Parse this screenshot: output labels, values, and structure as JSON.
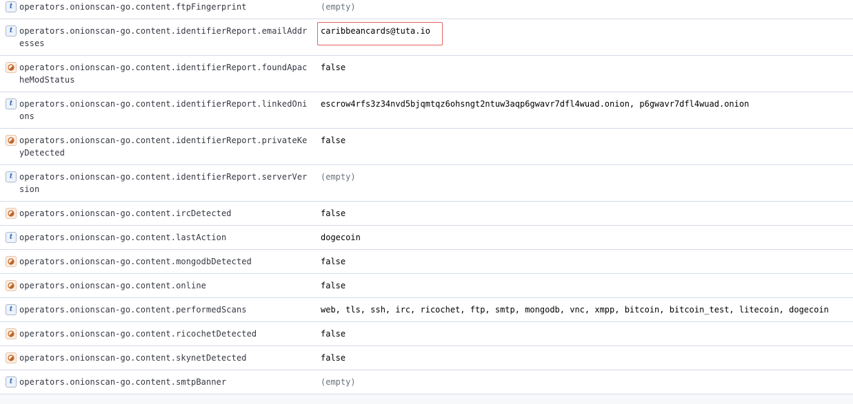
{
  "rows": [
    {
      "field": "operators.onionscan-go.content.ftpFingerprint",
      "type": "string",
      "type_glyph": "t",
      "value": "(empty)",
      "empty": true
    },
    {
      "field": "operators.onionscan-go.content.identifierReport.emailAddresses",
      "type": "string",
      "type_glyph": "t",
      "value": "caribbeancards@tuta.io",
      "empty": false,
      "highlighted": true
    },
    {
      "field": "operators.onionscan-go.content.identifierReport.foundApacheModStatus",
      "type": "boolean",
      "value": "false",
      "empty": false
    },
    {
      "field": "operators.onionscan-go.content.identifierReport.linkedOnions",
      "type": "string",
      "type_glyph": "t",
      "value": "escrow4rfs3z34nvd5bjqmtqz6ohsngt2ntuw3aqp6gwavr7dfl4wuad.onion, p6gwavr7dfl4wuad.onion",
      "empty": false
    },
    {
      "field": "operators.onionscan-go.content.identifierReport.privateKeyDetected",
      "type": "boolean",
      "value": "false",
      "empty": false
    },
    {
      "field": "operators.onionscan-go.content.identifierReport.serverVersion",
      "type": "string",
      "type_glyph": "t",
      "value": "(empty)",
      "empty": true
    },
    {
      "field": "operators.onionscan-go.content.ircDetected",
      "type": "boolean",
      "value": "false",
      "empty": false
    },
    {
      "field": "operators.onionscan-go.content.lastAction",
      "type": "string",
      "type_glyph": "t",
      "value": "dogecoin",
      "empty": false
    },
    {
      "field": "operators.onionscan-go.content.mongodbDetected",
      "type": "boolean",
      "value": "false",
      "empty": false
    },
    {
      "field": "operators.onionscan-go.content.online",
      "type": "boolean",
      "value": "false",
      "empty": false
    },
    {
      "field": "operators.onionscan-go.content.performedScans",
      "type": "string",
      "type_glyph": "t",
      "value": "web, tls, ssh, irc, ricochet, ftp, smtp, mongodb, vnc, xmpp, bitcoin, bitcoin_test, litecoin, dogecoin",
      "empty": false
    },
    {
      "field": "operators.onionscan-go.content.ricochetDetected",
      "type": "boolean",
      "value": "false",
      "empty": false
    },
    {
      "field": "operators.onionscan-go.content.skynetDetected",
      "type": "boolean",
      "value": "false",
      "empty": false
    },
    {
      "field": "operators.onionscan-go.content.smtpBanner",
      "type": "string",
      "type_glyph": "t",
      "value": "(empty)",
      "empty": true
    }
  ],
  "colors": {
    "highlight_border": "#e4605e",
    "string_icon": "#356ab3",
    "boolean_icon": "#c0652a",
    "row_divider": "#d3dae6",
    "empty_text": "#6a717d"
  },
  "icons": {
    "string": "string-type-icon",
    "boolean": "boolean-type-icon"
  }
}
